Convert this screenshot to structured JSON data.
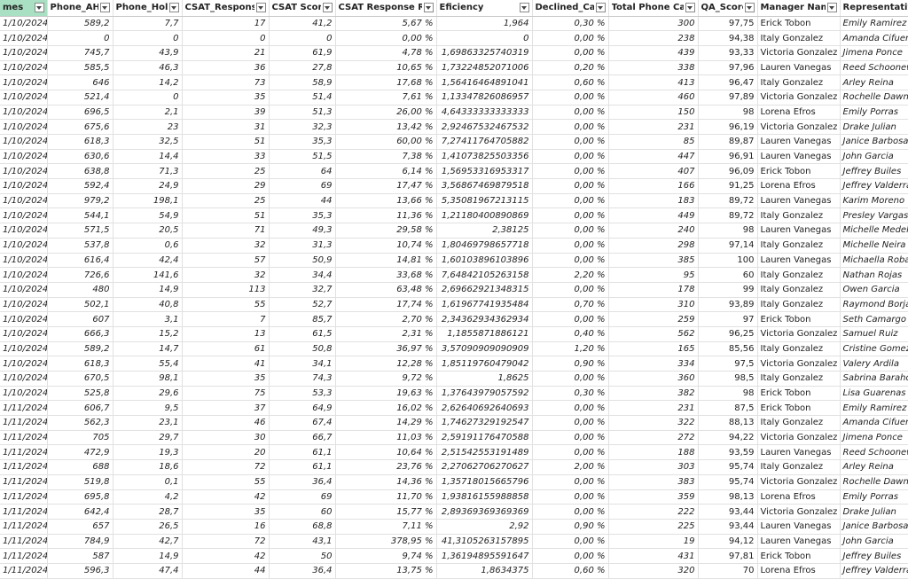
{
  "columns": [
    {
      "key": "mes",
      "label": "mes",
      "width": 53,
      "align": "txt",
      "selected": true
    },
    {
      "key": "aht",
      "label": "Phone_AHT",
      "width": 74,
      "align": "num"
    },
    {
      "key": "hold",
      "label": "Phone_Hold",
      "width": 78,
      "align": "num"
    },
    {
      "key": "resp",
      "label": "CSAT_Responses",
      "width": 98,
      "align": "num"
    },
    {
      "key": "score",
      "label": "CSAT Score",
      "width": 75,
      "align": "num"
    },
    {
      "key": "rate",
      "label": "CSAT Response Rate",
      "width": 114,
      "align": "num"
    },
    {
      "key": "eff",
      "label": "Eficiency",
      "width": 108,
      "align": "num"
    },
    {
      "key": "declined",
      "label": "Declined_Calls",
      "width": 86,
      "align": "num"
    },
    {
      "key": "calls",
      "label": "Total Phone Calls",
      "width": 101,
      "align": "num"
    },
    {
      "key": "qa",
      "label": "QA_Score",
      "width": 67,
      "align": "num"
    },
    {
      "key": "manager",
      "label": "Manager Name",
      "width": 93,
      "align": "txt"
    },
    {
      "key": "rep",
      "label": "Representative",
      "width": 94,
      "align": "txt"
    }
  ],
  "rows": [
    [
      "1/10/2024",
      "589,2",
      "7,7",
      "17",
      "41,2",
      "5,67 %",
      "1,964",
      "0,30 %",
      "300",
      "97,75",
      "Erick Tobon",
      "Emily Ramirez"
    ],
    [
      "1/10/2024",
      "0",
      "0",
      "0",
      "0",
      "0,00 %",
      "0",
      "0,00 %",
      "238",
      "94,38",
      "Italy Gonzalez",
      "Amanda Cifuentes"
    ],
    [
      "1/10/2024",
      "745,7",
      "43,9",
      "21",
      "61,9",
      "4,78 %",
      "1,69863325740319",
      "0,00 %",
      "439",
      "93,33",
      "Victoria Gonzalez",
      "Jimena Ponce"
    ],
    [
      "1/10/2024",
      "585,5",
      "46,3",
      "36",
      "27,8",
      "10,65 %",
      "1,73224852071006",
      "0,20 %",
      "338",
      "97,96",
      "Lauren Vanegas",
      "Reed Schoonewolff"
    ],
    [
      "1/10/2024",
      "646",
      "14,2",
      "73",
      "58,9",
      "17,68 %",
      "1,56416464891041",
      "0,60 %",
      "413",
      "96,47",
      "Italy Gonzalez",
      "Arley Reina"
    ],
    [
      "1/10/2024",
      "521,4",
      "0",
      "35",
      "51,4",
      "7,61 %",
      "1,13347826086957",
      "0,00 %",
      "460",
      "97,89",
      "Victoria Gonzalez",
      "Rochelle Dawn"
    ],
    [
      "1/10/2024",
      "696,5",
      "2,1",
      "39",
      "51,3",
      "26,00 %",
      "4,64333333333333",
      "0,00 %",
      "150",
      "98",
      "Lorena Efros",
      "Emily Porras"
    ],
    [
      "1/10/2024",
      "675,6",
      "23",
      "31",
      "32,3",
      "13,42 %",
      "2,92467532467532",
      "0,00 %",
      "231",
      "96,19",
      "Victoria Gonzalez",
      "Drake Julian"
    ],
    [
      "1/10/2024",
      "618,3",
      "32,5",
      "51",
      "35,3",
      "60,00 %",
      "7,27411764705882",
      "0,00 %",
      "85",
      "89,87",
      "Lauren Vanegas",
      "Janice Barbosa"
    ],
    [
      "1/10/2024",
      "630,6",
      "14,4",
      "33",
      "51,5",
      "7,38 %",
      "1,41073825503356",
      "0,00 %",
      "447",
      "96,91",
      "Lauren Vanegas",
      "John Garcia"
    ],
    [
      "1/10/2024",
      "638,8",
      "71,3",
      "25",
      "64",
      "6,14 %",
      "1,56953316953317",
      "0,00 %",
      "407",
      "96,09",
      "Erick Tobon",
      "Jeffrey Builes"
    ],
    [
      "1/10/2024",
      "592,4",
      "24,9",
      "29",
      "69",
      "17,47 %",
      "3,56867469879518",
      "0,00 %",
      "166",
      "91,25",
      "Lorena Efros",
      "Jeffrey Valderrama"
    ],
    [
      "1/10/2024",
      "979,2",
      "198,1",
      "25",
      "44",
      "13,66 %",
      "5,35081967213115",
      "0,00 %",
      "183",
      "89,72",
      "Lauren Vanegas",
      "Karim Moreno"
    ],
    [
      "1/10/2024",
      "544,1",
      "54,9",
      "51",
      "35,3",
      "11,36 %",
      "1,21180400890869",
      "0,00 %",
      "449",
      "89,72",
      "Italy Gonzalez",
      "Presley Vargas"
    ],
    [
      "1/10/2024",
      "571,5",
      "20,5",
      "71",
      "49,3",
      "29,58 %",
      "2,38125",
      "0,00 %",
      "240",
      "98",
      "Lauren Vanegas",
      "Michelle Medellin"
    ],
    [
      "1/10/2024",
      "537,8",
      "0,6",
      "32",
      "31,3",
      "10,74 %",
      "1,80469798657718",
      "0,00 %",
      "298",
      "97,14",
      "Italy Gonzalez",
      "Michelle Neira"
    ],
    [
      "1/10/2024",
      "616,4",
      "42,4",
      "57",
      "50,9",
      "14,81 %",
      "1,60103896103896",
      "0,00 %",
      "385",
      "100",
      "Lauren Vanegas",
      "Michaella Robayo"
    ],
    [
      "1/10/2024",
      "726,6",
      "141,6",
      "32",
      "34,4",
      "33,68 %",
      "7,64842105263158",
      "2,20 %",
      "95",
      "60",
      "Italy Gonzalez",
      "Nathan Rojas"
    ],
    [
      "1/10/2024",
      "480",
      "14,9",
      "113",
      "32,7",
      "63,48 %",
      "2,69662921348315",
      "0,00 %",
      "178",
      "99",
      "Italy Gonzalez",
      "Owen Garcia"
    ],
    [
      "1/10/2024",
      "502,1",
      "40,8",
      "55",
      "52,7",
      "17,74 %",
      "1,61967741935484",
      "0,70 %",
      "310",
      "93,89",
      "Italy Gonzalez",
      "Raymond Borjas"
    ],
    [
      "1/10/2024",
      "607",
      "3,1",
      "7",
      "85,7",
      "2,70 %",
      "2,34362934362934",
      "0,00 %",
      "259",
      "97",
      "Erick Tobon",
      "Seth Camargo"
    ],
    [
      "1/10/2024",
      "666,3",
      "15,2",
      "13",
      "61,5",
      "2,31 %",
      "1,1855871886121",
      "0,40 %",
      "562",
      "96,25",
      "Victoria Gonzalez",
      "Samuel Ruiz"
    ],
    [
      "1/10/2024",
      "589,2",
      "14,7",
      "61",
      "50,8",
      "36,97 %",
      "3,57090909090909",
      "1,20 %",
      "165",
      "85,56",
      "Italy Gonzalez",
      "Cristine Gomez"
    ],
    [
      "1/10/2024",
      "618,3",
      "55,4",
      "41",
      "34,1",
      "12,28 %",
      "1,85119760479042",
      "0,90 %",
      "334",
      "97,5",
      "Victoria Gonzalez",
      "Valery Ardila"
    ],
    [
      "1/10/2024",
      "670,5",
      "98,1",
      "35",
      "74,3",
      "9,72 %",
      "1,8625",
      "0,00 %",
      "360",
      "98,5",
      "Italy Gonzalez",
      "Sabrina Barahona"
    ],
    [
      "1/10/2024",
      "525,8",
      "29,6",
      "75",
      "53,3",
      "19,63 %",
      "1,37643979057592",
      "0,30 %",
      "382",
      "98",
      "Erick Tobon",
      "Lisa Guarenas"
    ],
    [
      "1/11/2024",
      "606,7",
      "9,5",
      "37",
      "64,9",
      "16,02 %",
      "2,62640692640693",
      "0,00 %",
      "231",
      "87,5",
      "Erick Tobon",
      "Emily Ramirez"
    ],
    [
      "1/11/2024",
      "562,3",
      "23,1",
      "46",
      "67,4",
      "14,29 %",
      "1,74627329192547",
      "0,00 %",
      "322",
      "88,13",
      "Italy Gonzalez",
      "Amanda Cifuentes"
    ],
    [
      "1/11/2024",
      "705",
      "29,7",
      "30",
      "66,7",
      "11,03 %",
      "2,59191176470588",
      "0,00 %",
      "272",
      "94,22",
      "Victoria Gonzalez",
      "Jimena Ponce"
    ],
    [
      "1/11/2024",
      "472,9",
      "19,3",
      "20",
      "61,1",
      "10,64 %",
      "2,51542553191489",
      "0,00 %",
      "188",
      "93,59",
      "Lauren Vanegas",
      "Reed Schoonewolff"
    ],
    [
      "1/11/2024",
      "688",
      "18,6",
      "72",
      "61,1",
      "23,76 %",
      "2,27062706270627",
      "2,00 %",
      "303",
      "95,74",
      "Italy Gonzalez",
      "Arley Reina"
    ],
    [
      "1/11/2024",
      "519,8",
      "0,1",
      "55",
      "36,4",
      "14,36 %",
      "1,35718015665796",
      "0,00 %",
      "383",
      "95,74",
      "Victoria Gonzalez",
      "Rochelle Dawn"
    ],
    [
      "1/11/2024",
      "695,8",
      "4,2",
      "42",
      "69",
      "11,70 %",
      "1,93816155988858",
      "0,00 %",
      "359",
      "98,13",
      "Lorena Efros",
      "Emily Porras"
    ],
    [
      "1/11/2024",
      "642,4",
      "28,7",
      "35",
      "60",
      "15,77 %",
      "2,89369369369369",
      "0,00 %",
      "222",
      "93,44",
      "Victoria Gonzalez",
      "Drake Julian"
    ],
    [
      "1/11/2024",
      "657",
      "26,5",
      "16",
      "68,8",
      "7,11 %",
      "2,92",
      "0,90 %",
      "225",
      "93,44",
      "Lauren Vanegas",
      "Janice Barbosa"
    ],
    [
      "1/11/2024",
      "784,9",
      "42,7",
      "72",
      "43,1",
      "378,95 %",
      "41,3105263157895",
      "0,00 %",
      "19",
      "94,12",
      "Lauren Vanegas",
      "John Garcia"
    ],
    [
      "1/11/2024",
      "587",
      "14,9",
      "42",
      "50",
      "9,74 %",
      "1,36194895591647",
      "0,00 %",
      "431",
      "97,81",
      "Erick Tobon",
      "Jeffrey Builes"
    ],
    [
      "1/11/2024",
      "596,3",
      "47,4",
      "44",
      "36,4",
      "13,75 %",
      "1,8634375",
      "0,60 %",
      "320",
      "70",
      "Lorena Efros",
      "Jeffrey Valderrama"
    ]
  ]
}
